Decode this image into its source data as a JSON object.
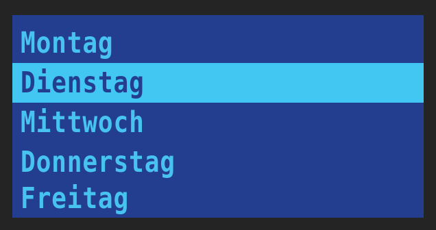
{
  "menu": {
    "items": [
      {
        "label": "Montag",
        "selected": false
      },
      {
        "label": "Dienstag",
        "selected": true
      },
      {
        "label": "Mittwoch",
        "selected": false
      },
      {
        "label": "Donnerstag",
        "selected": false
      },
      {
        "label": "Freitag",
        "selected": false
      }
    ]
  },
  "colors": {
    "bezel": "#242424",
    "screen_background": "#243e8f",
    "text": "#47c3f0",
    "highlight": "#42c6f2"
  }
}
